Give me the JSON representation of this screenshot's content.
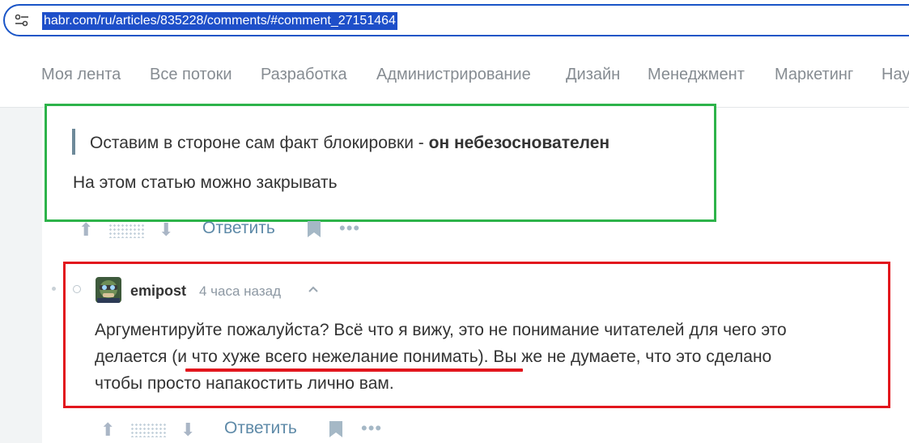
{
  "address_bar": {
    "url": "habr.com/ru/articles/835228/comments/#comment_27151464",
    "site_info_icon": "tune-icon"
  },
  "nav": {
    "items": [
      "Моя лента",
      "Все потоки",
      "Разработка",
      "Администрирование",
      "Дизайн",
      "Менеджмент",
      "Маркетинг",
      "Нау"
    ]
  },
  "comment1": {
    "quote_normal": "Оставим в стороне сам факт блокировки - ",
    "quote_bold": "он небезоснователен",
    "body": "На этом статью можно закрывать",
    "reply_label": "Ответить"
  },
  "comment2": {
    "username": "emipost",
    "time": "4 часа назад",
    "line1": "Аргументируйте пожалуйста? Всё что я вижу, это не понимание читателей для чего это",
    "line2": "делается (и что хуже всего нежелание понимать). Вы же не думаете, что это сделано",
    "line3": "чтобы просто напакостить лично вам.",
    "reply_label": "Ответить"
  },
  "annotations": {
    "green_box_color": "#2db34a",
    "red_box_color": "#e2161d"
  },
  "icons": [
    "tune-icon",
    "arrow-up-icon",
    "arrow-down-icon",
    "bookmark-icon",
    "more-icon",
    "chevron-up-icon",
    "avatar"
  ]
}
